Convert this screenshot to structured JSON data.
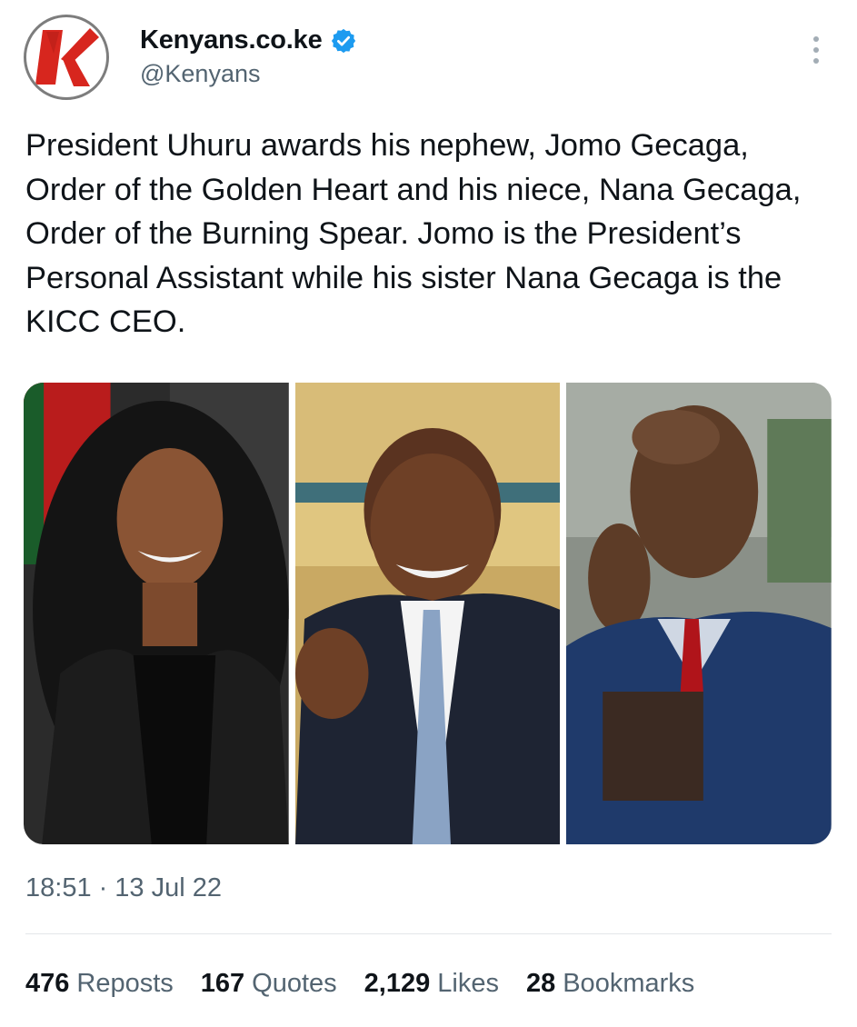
{
  "author": {
    "display_name": "Kenyans.co.ke",
    "handle": "@Kenyans",
    "verified": true,
    "avatar_icon": "kenyans-k-logo-icon",
    "avatar_letter": "K"
  },
  "tweet": {
    "text": "President Uhuru awards his nephew, Jomo Gecaga, Order of the Golden Heart and his niece, Nana Gecaga, Order of the Burning Spear. Jomo is the President’s Personal Assistant while his sister Nana Gecaga is the KICC CEO.",
    "time": "18:51",
    "separator": "·",
    "date": "13 Jul 22"
  },
  "stats": [
    {
      "count": "476",
      "label": "Reposts"
    },
    {
      "count": "167",
      "label": "Quotes"
    },
    {
      "count": "2,129",
      "label": "Likes"
    },
    {
      "count": "28",
      "label": "Bookmarks"
    }
  ],
  "colors": {
    "verified": "#1d9bf0",
    "logo_red": "#d7261e",
    "text_primary": "#0f1419",
    "text_secondary": "#536471"
  }
}
